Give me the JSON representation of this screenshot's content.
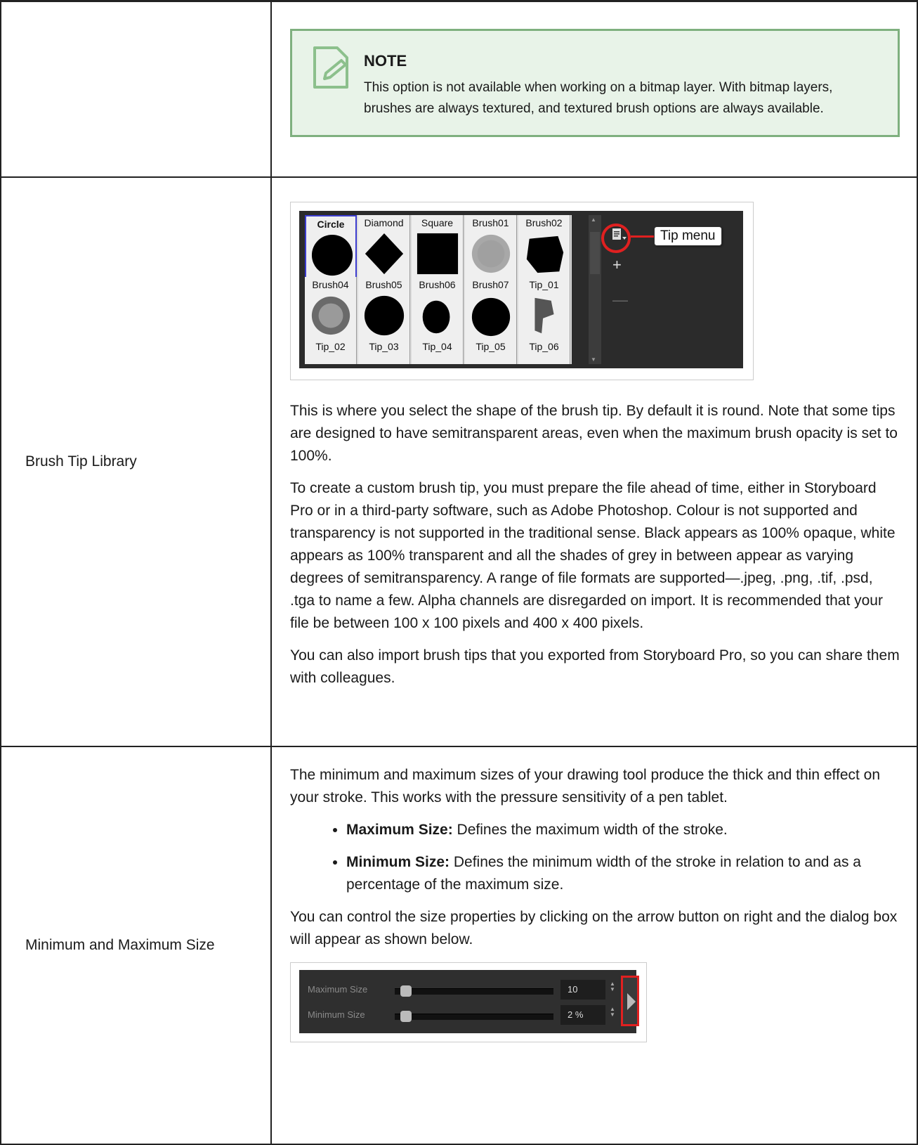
{
  "note": {
    "title": "NOTE",
    "text": "This option is not available when working on a bitmap layer. With bitmap layers, brushes are always textured, and textured brush options are always available."
  },
  "rows": {
    "brush_tip": {
      "label": "Brush Tip Library",
      "tips": [
        "Circle",
        "Diamond",
        "Square",
        "Brush01",
        "Brush02",
        "Brush04",
        "Brush05",
        "Brush06",
        "Brush07",
        "Tip_01",
        "Tip_02",
        "Tip_03",
        "Tip_04",
        "Tip_05",
        "Tip_06"
      ],
      "callout": "Tip menu",
      "p1": "This is where you select the shape of the brush tip. By default it is round. Note that some tips are designed to have semitransparent areas, even when the maximum brush opacity is set to 100%.",
      "p2": "To create a custom brush tip, you must prepare the file ahead of time, either in Storyboard Pro or in a third-party software, such as Adobe Photoshop. Colour is not supported and transparency is not supported in the traditional sense. Black appears as 100% opaque, white appears as 100% transparent and all the shades of grey in between appear as varying degrees of semitransparency. A range of file formats are supported—.jpeg, .png, .tif, .psd, .tga to name a few. Alpha channels are disregarded on import. It is recommended that your file be between 100 x 100 pixels and 400 x 400 pixels.",
      "p3": "You can also import brush tips that you exported from Storyboard Pro, so you can share them with colleagues."
    },
    "size": {
      "label": "Minimum and Maximum Size",
      "p1": "The minimum and maximum sizes of your drawing tool produce the thick and thin effect on your stroke. This works with the pressure sensitivity of a pen tablet.",
      "bullets": [
        {
          "term": "Maximum Size:",
          "desc": " Defines the maximum width of the stroke."
        },
        {
          "term": "Minimum Size:",
          "desc": " Defines the minimum width of the stroke in relation to and as a percentage of the maximum size."
        }
      ],
      "p2": "You can control the size properties by clicking on the arrow button on right and the dialog box will appear as shown below.",
      "widget": {
        "max_label": "Maximum Size",
        "max_value": "10",
        "min_label": "Minimum Size",
        "min_value": "2 %"
      }
    }
  }
}
